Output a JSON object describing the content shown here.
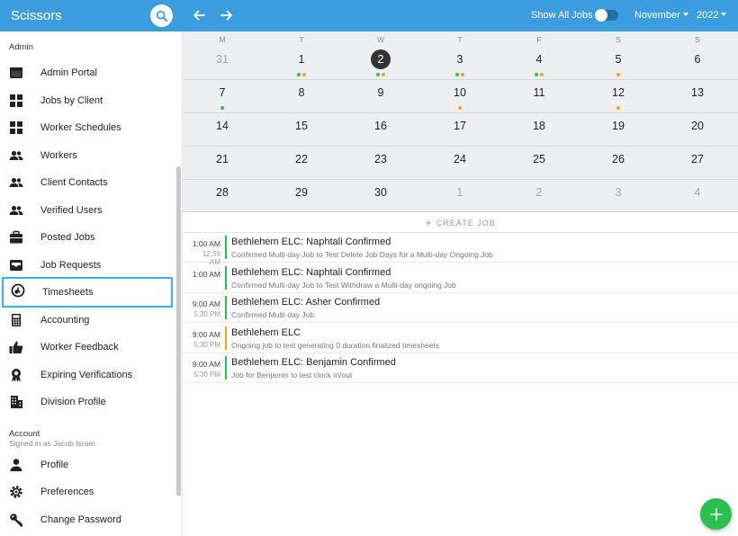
{
  "app": {
    "title": "Scissors"
  },
  "sidebar": {
    "sections": {
      "admin": "Admin",
      "account": "Account"
    },
    "signed_in": "Signed in as Jacob Israel.",
    "admin_items": [
      {
        "label": "Admin Portal",
        "icon": "dashboard-icon"
      },
      {
        "label": "Jobs by Client",
        "icon": "grid-icon"
      },
      {
        "label": "Worker Schedules",
        "icon": "grid-icon"
      },
      {
        "label": "Workers",
        "icon": "people-icon"
      },
      {
        "label": "Client Contacts",
        "icon": "people-icon"
      },
      {
        "label": "Verified Users",
        "icon": "people-icon"
      },
      {
        "label": "Posted Jobs",
        "icon": "briefcase-icon"
      },
      {
        "label": "Job Requests",
        "icon": "inbox-icon"
      },
      {
        "label": "Timesheets",
        "icon": "clock-icon",
        "active": true
      },
      {
        "label": "Accounting",
        "icon": "calculator-icon"
      },
      {
        "label": "Worker Feedback",
        "icon": "thumbs-up-icon"
      },
      {
        "label": "Expiring Verifications",
        "icon": "award-icon"
      },
      {
        "label": "Division Profile",
        "icon": "building-icon"
      }
    ],
    "account_items": [
      {
        "label": "Profile",
        "icon": "person-icon"
      },
      {
        "label": "Preferences",
        "icon": "gear-icon"
      },
      {
        "label": "Change Password",
        "icon": "key-icon"
      }
    ]
  },
  "topbar": {
    "show_all_label": "Show All Jobs",
    "show_all_on": false,
    "month": "November",
    "year": "2022"
  },
  "calendar": {
    "weekdays": [
      "M",
      "T",
      "W",
      "T",
      "F",
      "S",
      "S"
    ],
    "weeks": [
      [
        {
          "d": "31",
          "muted": true
        },
        {
          "d": "1",
          "dots": [
            "g",
            "o"
          ]
        },
        {
          "d": "2",
          "today": true,
          "dots": [
            "g",
            "o"
          ]
        },
        {
          "d": "3",
          "dots": [
            "g",
            "o"
          ]
        },
        {
          "d": "4",
          "dots": [
            "g",
            "o"
          ]
        },
        {
          "d": "5",
          "dots": [
            "o"
          ]
        },
        {
          "d": "6"
        }
      ],
      [
        {
          "d": "7",
          "dots": [
            "g"
          ]
        },
        {
          "d": "8"
        },
        {
          "d": "9"
        },
        {
          "d": "10",
          "dots": [
            "o"
          ]
        },
        {
          "d": "11"
        },
        {
          "d": "12",
          "dots": [
            "o"
          ]
        },
        {
          "d": "13"
        }
      ],
      [
        {
          "d": "14"
        },
        {
          "d": "15"
        },
        {
          "d": "16"
        },
        {
          "d": "17"
        },
        {
          "d": "18"
        },
        {
          "d": "19"
        },
        {
          "d": "20"
        }
      ],
      [
        {
          "d": "21"
        },
        {
          "d": "22"
        },
        {
          "d": "23"
        },
        {
          "d": "24"
        },
        {
          "d": "25"
        },
        {
          "d": "26"
        },
        {
          "d": "27"
        }
      ],
      [
        {
          "d": "28"
        },
        {
          "d": "29"
        },
        {
          "d": "30"
        },
        {
          "d": "1",
          "muted": true
        },
        {
          "d": "2",
          "muted": true
        },
        {
          "d": "3",
          "muted": true
        },
        {
          "d": "4",
          "muted": true
        }
      ]
    ]
  },
  "create_job_label": "CREATE JOB",
  "jobs": [
    {
      "start": "1:00 AM",
      "end": "12:59 AM",
      "title": "Bethlehem ELC: Naphtali Confirmed",
      "desc": "Confirmed Multi-day Job to Test Delete Job Days for a Multi-day Ongoing Job",
      "color": "#2bbf4f"
    },
    {
      "start": "1:00 AM",
      "end": "",
      "title": "Bethlehem ELC: Naphtali Confirmed",
      "desc": "Confirmed Multi-day Job to Test Withdraw a Multi-day ongoing Job",
      "color": "#2bbf4f"
    },
    {
      "start": "9:00 AM",
      "end": "5:30 PM",
      "title": "Bethlehem ELC: Asher Confirmed",
      "desc": "Confirmed Multi-day Job",
      "color": "#2bbf4f"
    },
    {
      "start": "9:00 AM",
      "end": "5:30 PM",
      "title": "Bethlehem ELC",
      "desc": "Ongoing job to test generating 0 duration finalized timesheets",
      "color": "#f0a21a"
    },
    {
      "start": "9:00 AM",
      "end": "5:30 PM",
      "title": "Bethlehem ELC: Benjamin Confirmed",
      "desc": "Job for Benjamin to test clock in/out",
      "color": "#2bbf4f"
    }
  ],
  "colors": {
    "brand": "#3b9ddd",
    "confirmed": "#2bbf4f",
    "pending": "#f0a21a",
    "active_outline": "#35b4e6"
  },
  "fab_icon": "plus-icon"
}
